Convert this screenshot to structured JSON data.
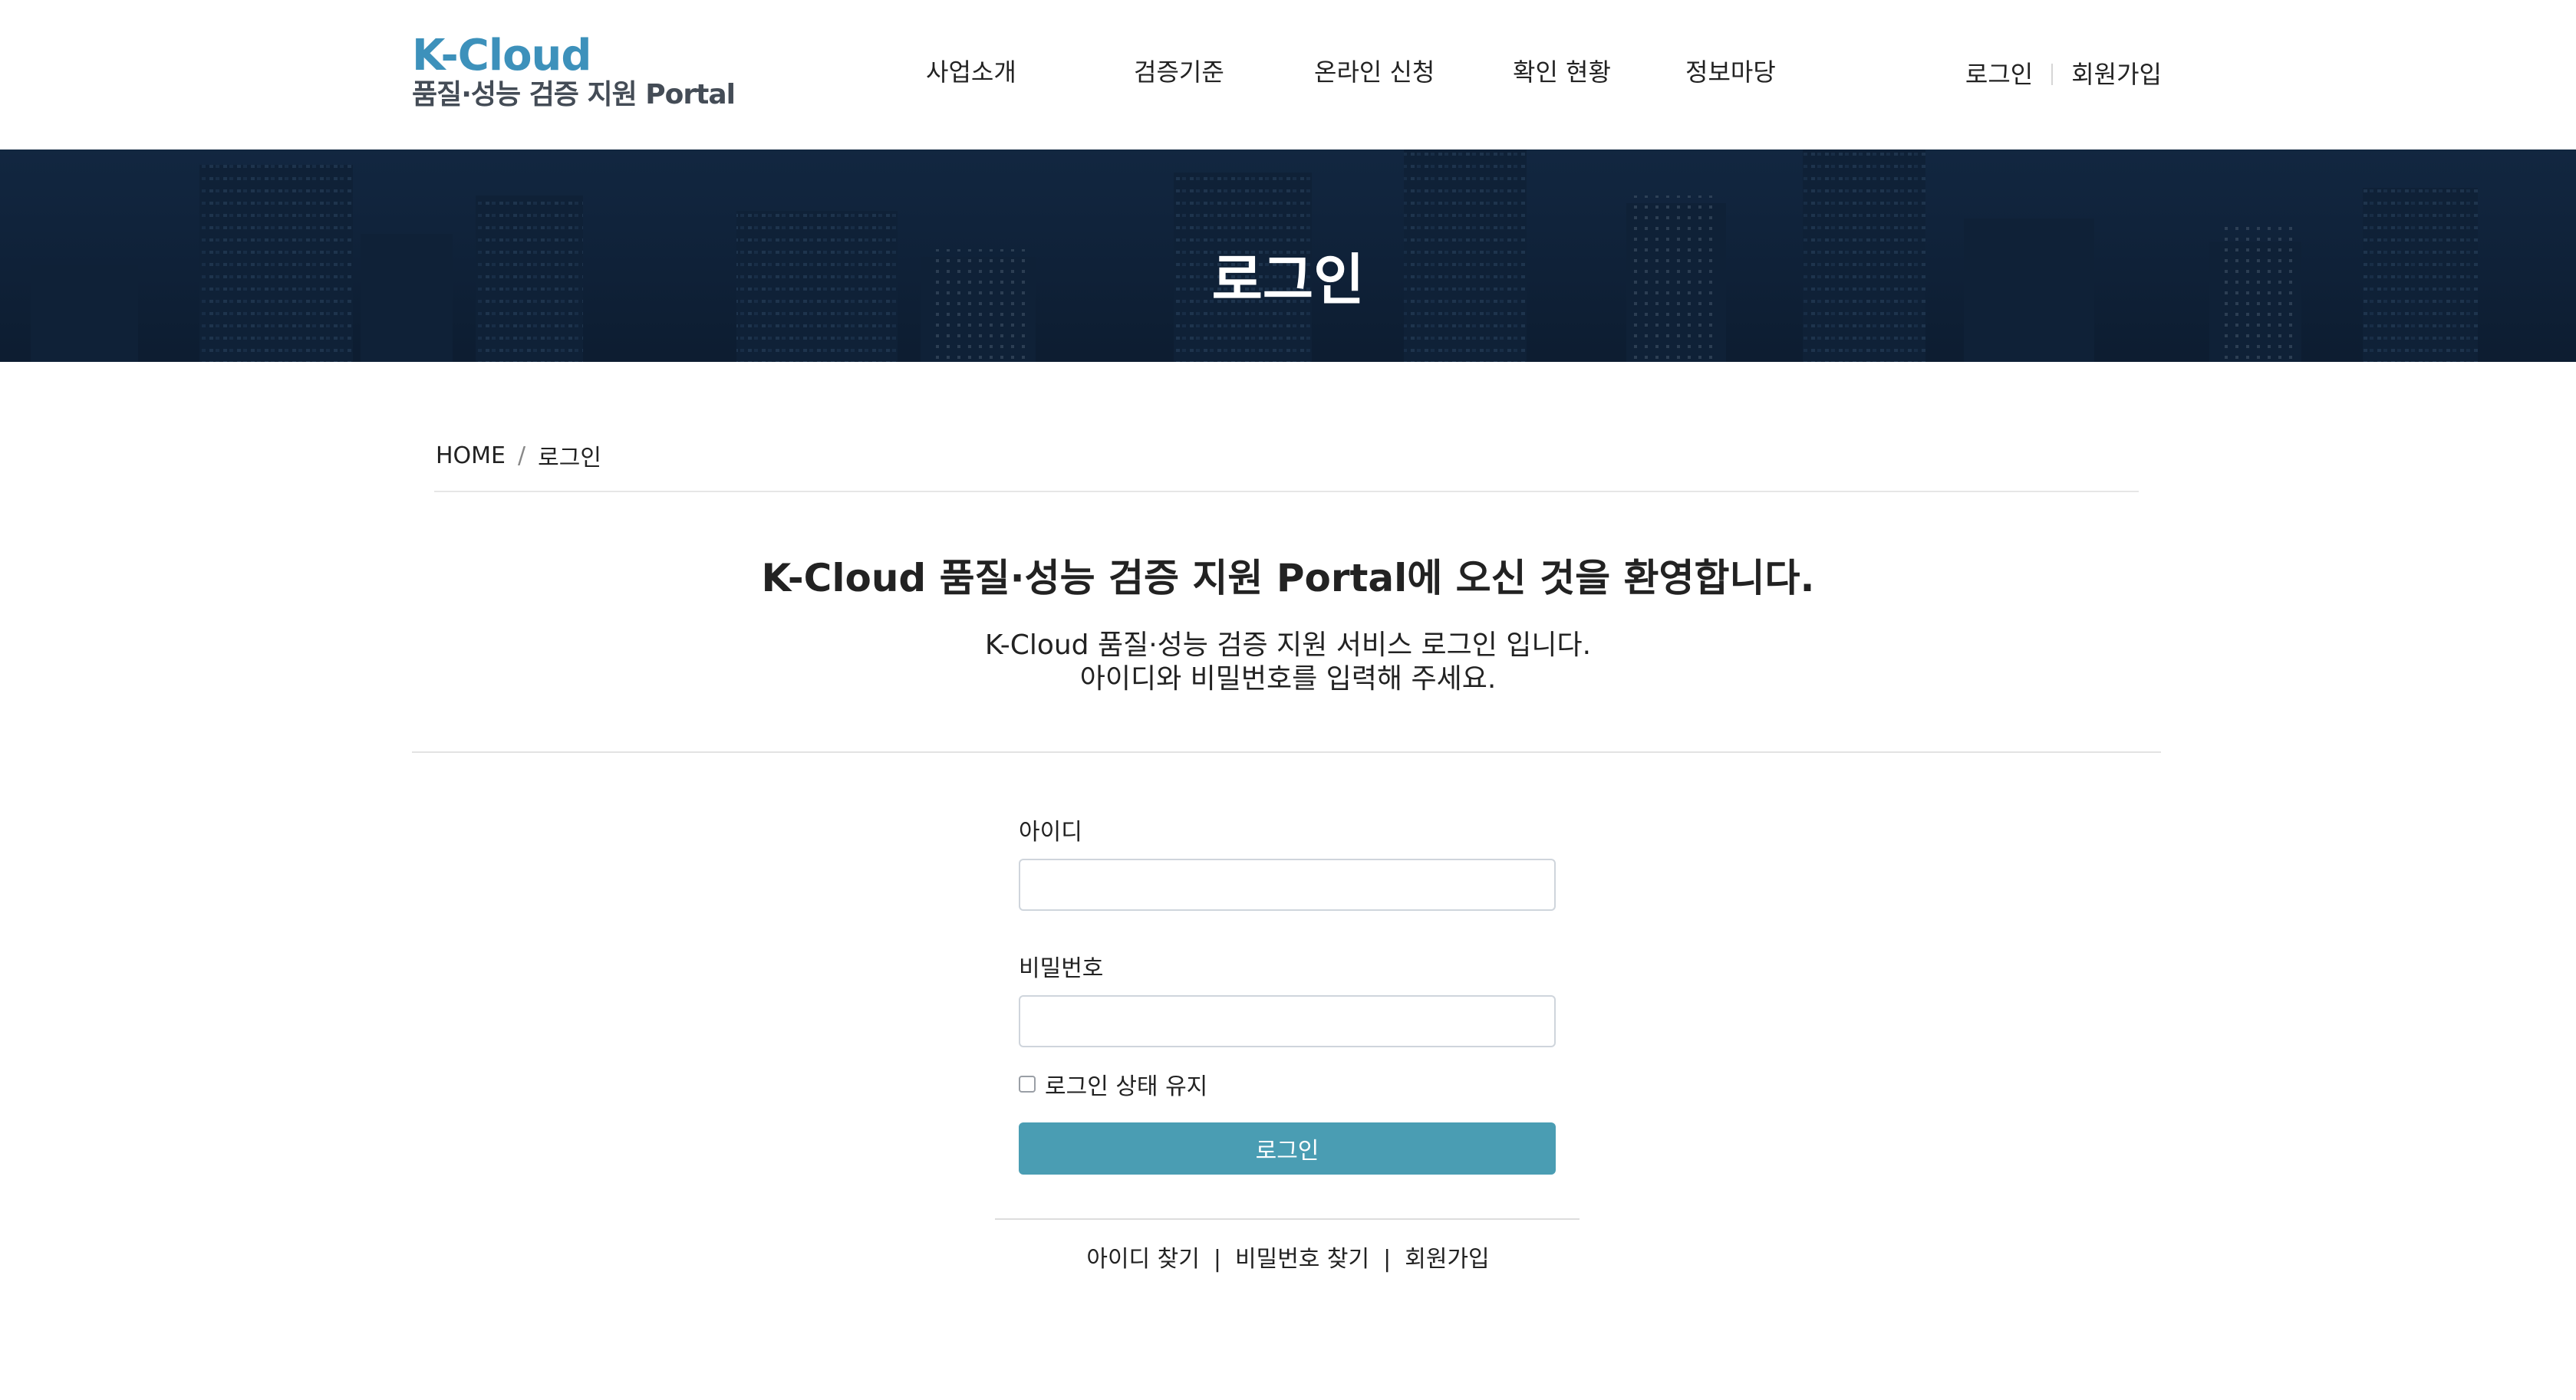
{
  "brand": {
    "name": "K-Cloud",
    "subtitle": "품질·성능 검증 지원 Portal",
    "accent": "#3d91bb"
  },
  "nav": {
    "items": [
      "사업소개",
      "검증기준",
      "온라인 신청",
      "확인 현황",
      "정보마당"
    ]
  },
  "util": {
    "login": "로그인",
    "signup": "회원가입"
  },
  "hero": {
    "title": "로그인"
  },
  "breadcrumb": {
    "home": "HOME",
    "separator": "/",
    "current": "로그인"
  },
  "welcome": {
    "title": "K-Cloud 품질·성능 검증 지원 Portal에 오신 것을 환영합니다.",
    "line1": "K-Cloud 품질·성능 검증 지원 서비스 로그인 입니다.",
    "line2": "아이디와 비밀번호를 입력해 주세요."
  },
  "form": {
    "id_label": "아이디",
    "id_value": "",
    "password_label": "비밀번호",
    "password_value": "",
    "remember_label": "로그인 상태 유지",
    "remember_checked": false,
    "submit_label": "로그인",
    "button_color": "#4a9db3"
  },
  "links": {
    "find_id": "아이디 찾기",
    "find_password": "비밀번호 찾기",
    "signup": "회원가입",
    "separator": "|"
  }
}
